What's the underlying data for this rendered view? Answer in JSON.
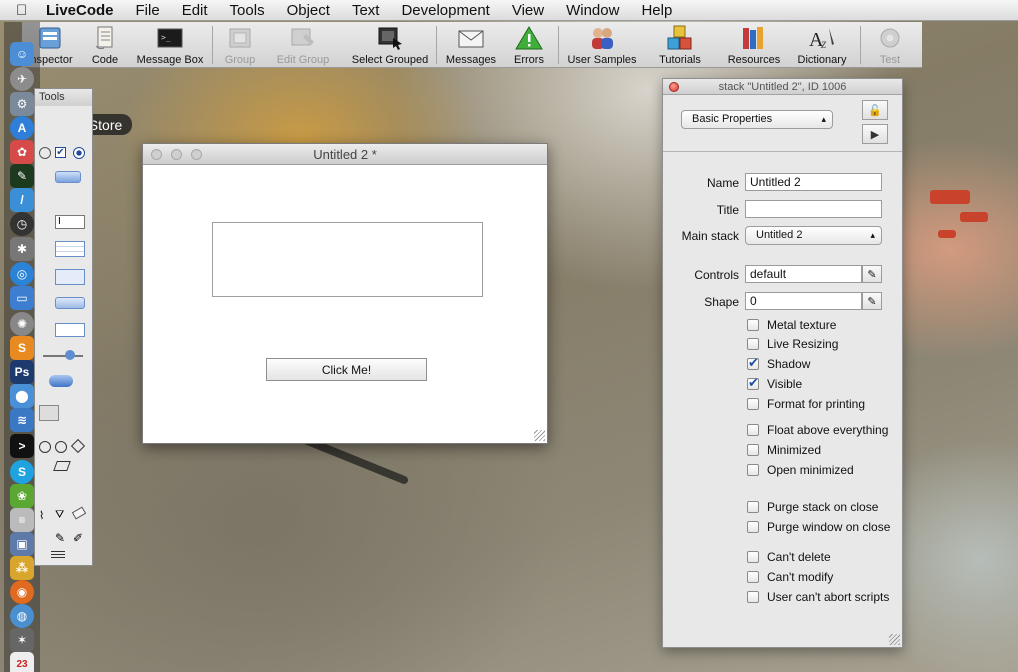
{
  "menubar": {
    "items": [
      "LiveCode",
      "File",
      "Edit",
      "Tools",
      "Object",
      "Text",
      "Development",
      "View",
      "Window",
      "Help"
    ]
  },
  "toolbar": {
    "items": [
      {
        "label": "Inspector",
        "icon": "inspector-icon",
        "enabled": true
      },
      {
        "label": "Code",
        "icon": "code-icon",
        "enabled": true
      },
      {
        "label": "Message Box",
        "icon": "message-box-icon",
        "enabled": true
      },
      {
        "label": "Group",
        "icon": "group-icon",
        "enabled": false
      },
      {
        "label": "Edit Group",
        "icon": "edit-group-icon",
        "enabled": false
      },
      {
        "label": "Select Grouped",
        "icon": "select-grouped-icon",
        "enabled": true
      },
      {
        "label": "Messages",
        "icon": "messages-icon",
        "enabled": true
      },
      {
        "label": "Errors",
        "icon": "errors-icon",
        "enabled": true
      },
      {
        "label": "User Samples",
        "icon": "user-samples-icon",
        "enabled": true
      },
      {
        "label": "Tutorials",
        "icon": "tutorials-icon",
        "enabled": true
      },
      {
        "label": "Resources",
        "icon": "resources-icon",
        "enabled": true
      },
      {
        "label": "Dictionary",
        "icon": "dictionary-icon",
        "enabled": true
      },
      {
        "label": "Test",
        "icon": "test-icon",
        "enabled": false
      }
    ]
  },
  "dock": {
    "tooltip": "App Store"
  },
  "tools_palette": {
    "title": "Tools",
    "field_sample": "I"
  },
  "stack_window": {
    "title": "Untitled 2 *",
    "button_label": "Click Me!"
  },
  "inspector": {
    "title": "stack \"Untitled 2\", ID 1006",
    "section": "Basic Properties",
    "fields": {
      "name_label": "Name",
      "name_value": "Untitled 2",
      "title_label": "Title",
      "title_value": "",
      "mainstack_label": "Main stack",
      "mainstack_value": "Untitled 2",
      "controls_label": "Controls",
      "controls_value": "default",
      "shape_label": "Shape",
      "shape_value": "0"
    },
    "checkboxes": [
      {
        "label": "Metal texture",
        "checked": false
      },
      {
        "label": "Live Resizing",
        "checked": false
      },
      {
        "label": "Shadow",
        "checked": true
      },
      {
        "label": "Visible",
        "checked": true
      },
      {
        "label": "Format for printing",
        "checked": false
      },
      {
        "label": "Float above everything",
        "checked": false
      },
      {
        "label": "Minimized",
        "checked": false
      },
      {
        "label": "Open minimized",
        "checked": false
      },
      {
        "label": "Purge stack on close",
        "checked": false
      },
      {
        "label": "Purge window on close",
        "checked": false
      },
      {
        "label": "Can't delete",
        "checked": false
      },
      {
        "label": "Can't modify",
        "checked": false
      },
      {
        "label": "User can't abort scripts",
        "checked": false
      }
    ]
  }
}
